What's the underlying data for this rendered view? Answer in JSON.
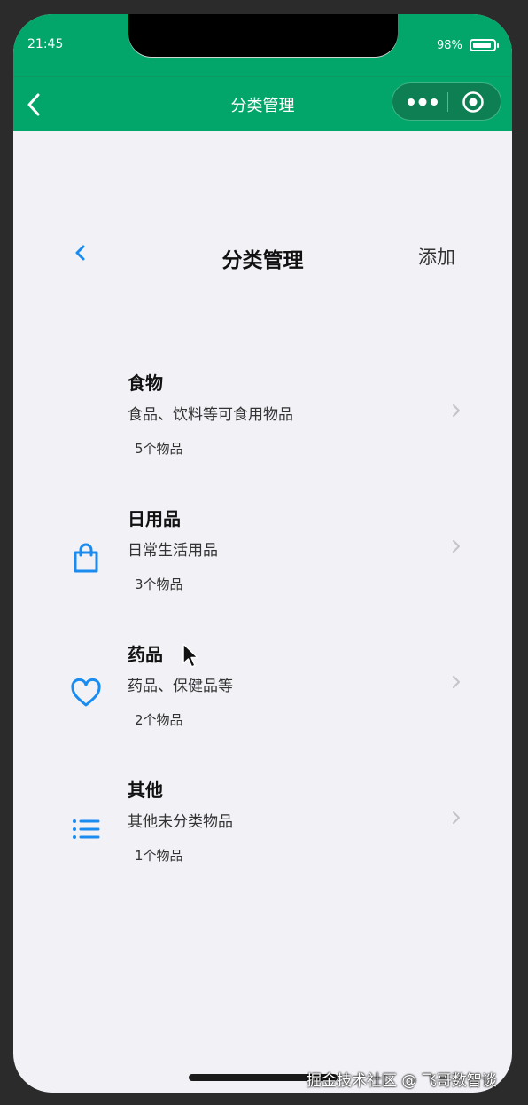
{
  "status_bar": {
    "time": "21:45",
    "battery": "98%"
  },
  "nav_bar": {
    "title": "分类管理"
  },
  "page_header": {
    "title": "分类管理",
    "add_label": "添加"
  },
  "categories": [
    {
      "name": "食物",
      "description": "食品、饮料等可食用物品",
      "count": "5个物品",
      "icon": "none"
    },
    {
      "name": "日用品",
      "description": "日常生活用品",
      "count": "3个物品",
      "icon": "shopping-bag-icon"
    },
    {
      "name": "药品",
      "description": "药品、保健品等",
      "count": "2个物品",
      "icon": "heart-icon"
    },
    {
      "name": "其他",
      "description": "其他未分类物品",
      "count": "1个物品",
      "icon": "list-icon"
    }
  ],
  "colors": {
    "brand_green": "#03a66a",
    "accent_blue": "#1a8cf0",
    "page_background": "#f1f1f6"
  },
  "watermark": "掘金技术社区 @ 飞哥数智谈"
}
